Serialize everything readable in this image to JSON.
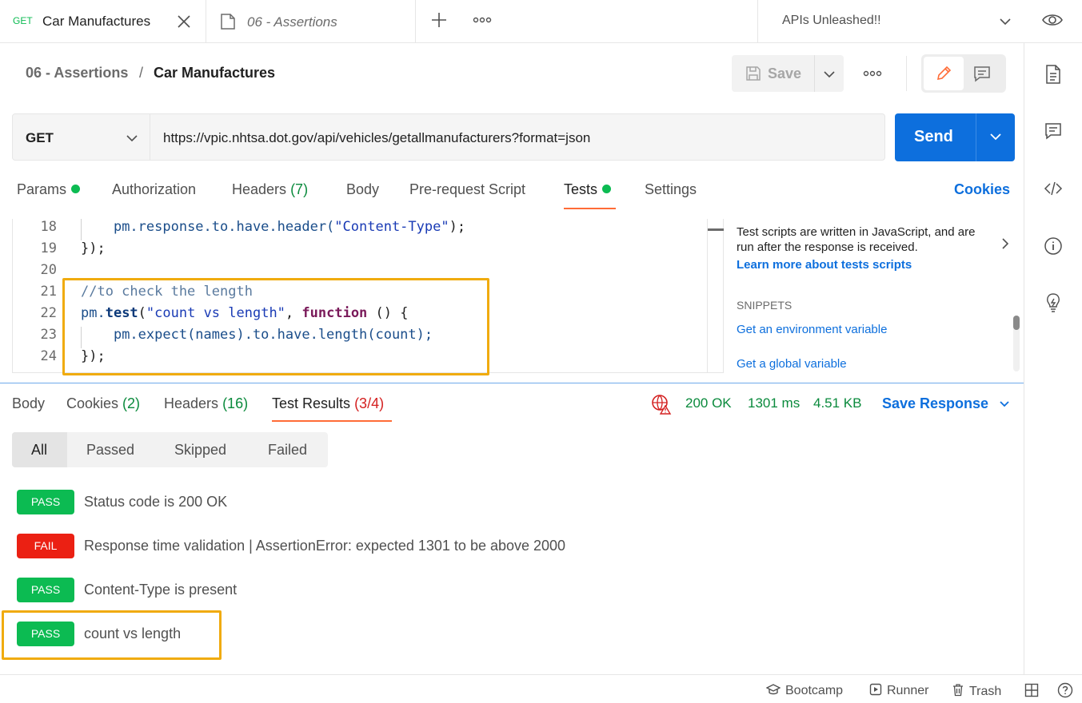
{
  "tabs": {
    "active": {
      "method": "GET",
      "title": "Car Manufactures"
    },
    "second": {
      "title": "06 - Assertions"
    },
    "workspace": "APIs Unleashed!!"
  },
  "breadcrumb": {
    "collection": "06 - Assertions",
    "separator": "/",
    "request": "Car Manufactures"
  },
  "toolbar": {
    "save_label": "Save"
  },
  "request": {
    "method": "GET",
    "url": "https://vpic.nhtsa.dot.gov/api/vehicles/getallmanufacturers?format=json",
    "send_label": "Send"
  },
  "request_tabs": {
    "params": "Params",
    "authorization": "Authorization",
    "headers": "Headers",
    "headers_count": "(7)",
    "body": "Body",
    "prerequest": "Pre-request Script",
    "tests": "Tests",
    "settings": "Settings",
    "cookies": "Cookies"
  },
  "editor": {
    "lines": [
      {
        "num": "18",
        "indent": "    ",
        "parts": [
          [
            "prop",
            "pm.response.to.have.header("
          ],
          [
            "str",
            "\"Content-Type\""
          ],
          [
            "plain",
            ");"
          ]
        ]
      },
      {
        "num": "19",
        "indent": "",
        "parts": [
          [
            "plain",
            "});"
          ]
        ]
      },
      {
        "num": "20",
        "indent": "",
        "parts": []
      },
      {
        "num": "21",
        "indent": "",
        "parts": [
          [
            "comment",
            "//to check the length"
          ]
        ]
      },
      {
        "num": "22",
        "indent": "",
        "parts": [
          [
            "prop",
            "pm."
          ],
          [
            "fn",
            "test"
          ],
          [
            "plain",
            "("
          ],
          [
            "str",
            "\"count vs length\""
          ],
          [
            "plain",
            ", "
          ],
          [
            "kw",
            "function"
          ],
          [
            "plain",
            " () {"
          ]
        ]
      },
      {
        "num": "23",
        "indent": "    ",
        "parts": [
          [
            "prop",
            "pm.expect(names).to.have.length(count);"
          ]
        ]
      },
      {
        "num": "24",
        "indent": "",
        "parts": [
          [
            "plain",
            "});"
          ]
        ]
      }
    ]
  },
  "snippets": {
    "intro": "Test scripts are written in JavaScript, and are run after the response is received.",
    "learn_more": "Learn more about tests scripts",
    "title": "SNIPPETS",
    "items": [
      "Get an environment variable",
      "Get a global variable"
    ]
  },
  "response_tabs": {
    "body": "Body",
    "cookies": "Cookies",
    "cookies_count": "(2)",
    "headers": "Headers",
    "headers_count": "(16)",
    "test_results": "Test Results",
    "test_results_count": "(3/4)"
  },
  "response_meta": {
    "status": "200 OK",
    "time": "1301 ms",
    "size": "4.51 KB",
    "save_response": "Save Response"
  },
  "filters": [
    "All",
    "Passed",
    "Skipped",
    "Failed"
  ],
  "results": [
    {
      "status": "PASS",
      "text": "Status code is 200 OK"
    },
    {
      "status": "FAIL",
      "text": "Response time validation | AssertionError: expected 1301 to be above 2000"
    },
    {
      "status": "PASS",
      "text": "Content-Type is present"
    },
    {
      "status": "PASS",
      "text": "count vs length"
    }
  ],
  "footer": {
    "bootcamp": "Bootcamp",
    "runner": "Runner",
    "trash": "Trash"
  },
  "colors": {
    "accent": "#ff6c37",
    "primary": "#0d6fdd",
    "pass": "#0cbb52",
    "fail": "#eb2013",
    "highlight": "#f0ab0f"
  }
}
